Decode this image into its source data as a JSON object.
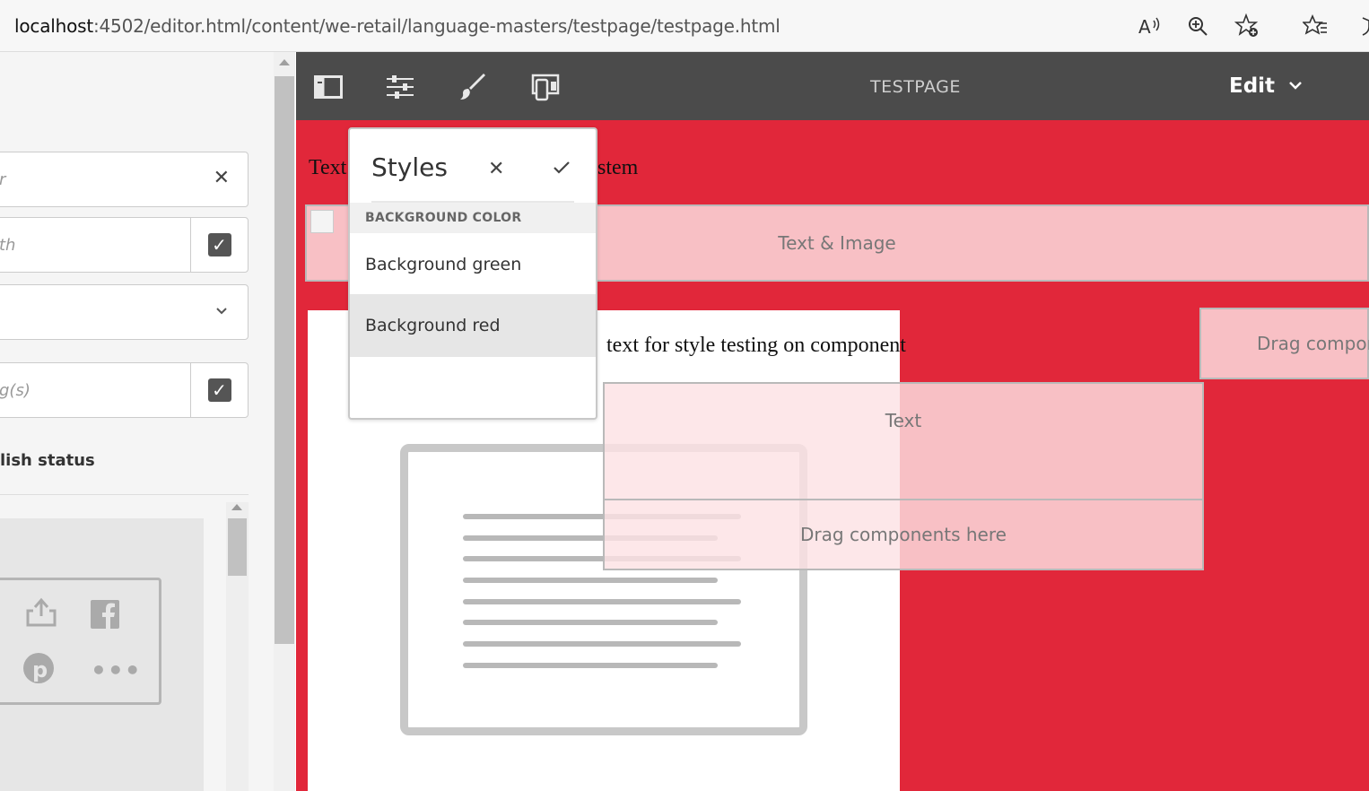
{
  "browser": {
    "url_host": "localhost",
    "url_rest": ":4502/editor.html/content/we-retail/language-masters/testpage/testpage.html"
  },
  "side_panel": {
    "field1_placeholder": "r",
    "field2_placeholder": "th",
    "field4_placeholder": "g(s)",
    "publish_status_label": "lish status"
  },
  "toolbar": {
    "page_title": "TESTPAGE",
    "mode_label": "Edit"
  },
  "canvas": {
    "title_text_left": "Text",
    "title_text_right": "stem",
    "text_image_placeholder": "Text & Image",
    "component_text": "text for style testing on component",
    "drag_components_right": "Drag compon",
    "text_placeholder": "Text",
    "drag_components_here": "Drag components here"
  },
  "styles_popover": {
    "title": "Styles",
    "group_label": "BACKGROUND COLOR",
    "items": [
      {
        "label": "Background green",
        "selected": false
      },
      {
        "label": "Background red",
        "selected": true
      }
    ]
  },
  "colors": {
    "canvas_bg": "#e1273a",
    "toolbar_bg": "#4b4b4b",
    "placeholder_bg": "#fce2e4"
  }
}
